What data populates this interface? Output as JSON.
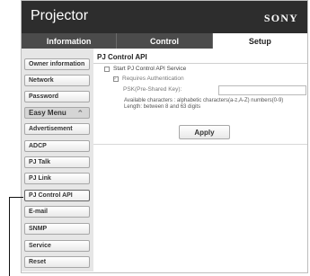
{
  "header": {
    "title": "Projector",
    "brand": "SONY"
  },
  "tabs": [
    {
      "label": "Information",
      "active": false
    },
    {
      "label": "Control",
      "active": false
    },
    {
      "label": "Setup",
      "active": true
    }
  ],
  "sidebar": {
    "items": [
      {
        "label": "Owner information"
      },
      {
        "label": "Network"
      },
      {
        "label": "Password"
      },
      {
        "label": "Easy Menu",
        "group": true,
        "icon": "chevron-up-icon",
        "glyph": "⌃"
      },
      {
        "label": "Advertisement"
      },
      {
        "label": "ADCP"
      },
      {
        "label": "PJ Talk"
      },
      {
        "label": "PJ Link"
      },
      {
        "label": "PJ Control API",
        "selected": true
      },
      {
        "label": "E-mail"
      },
      {
        "label": "SNMP"
      },
      {
        "label": "Service"
      },
      {
        "label": "Reset"
      }
    ]
  },
  "main": {
    "title": "PJ Control API",
    "start_service_label": "Start PJ Control API Service",
    "requires_auth_label": "Requires Authentication",
    "psk_label": "PSK(Pre-Shared Key):",
    "psk_value": "",
    "help_line1": "Available characters : alphabetic characters(a-z,A-Z) numbers(0-9)",
    "help_line2": "Length: between 8 and 63 digits",
    "apply_label": "Apply"
  }
}
